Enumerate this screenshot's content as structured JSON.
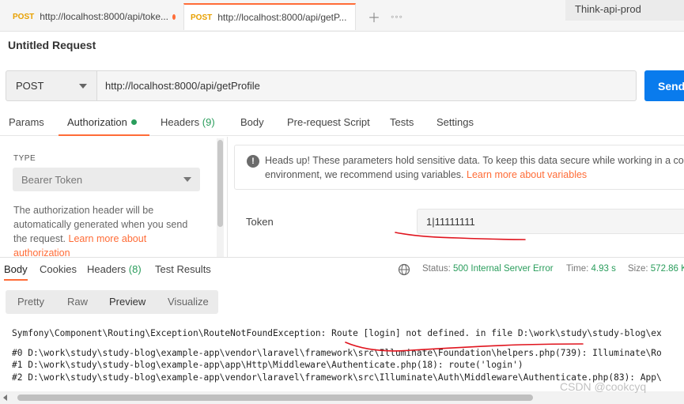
{
  "tabs": [
    {
      "method": "POST",
      "url": "http://localhost:8000/api/toke..."
    },
    {
      "method": "POST",
      "url": "http://localhost:8000/api/getP..."
    }
  ],
  "environment": "Think-api-prod",
  "request": {
    "title": "Untitled Request",
    "method": "POST",
    "url": "http://localhost:8000/api/getProfile",
    "send_label": "Send"
  },
  "request_tabs": {
    "params": "Params",
    "authorization": "Authorization",
    "headers": "Headers",
    "headers_count": "(9)",
    "body": "Body",
    "prerequest": "Pre-request Script",
    "tests": "Tests",
    "settings": "Settings"
  },
  "auth": {
    "type_label": "TYPE",
    "type_value": "Bearer Token",
    "description": "The authorization header will be automatically generated when you send the request.",
    "learn_more": "Learn more about authorization",
    "notice_text": "Heads up! These parameters hold sensitive data. To keep this data secure while working in a co environment, we recommend using variables.",
    "notice_link": "Learn more about variables",
    "token_label": "Token",
    "token_value": "1|11111111"
  },
  "response": {
    "tabs": {
      "body": "Body",
      "cookies": "Cookies",
      "headers": "Headers",
      "headers_count": "(8)",
      "test_results": "Test Results"
    },
    "status_label": "Status:",
    "status_value": "500 Internal Server Error",
    "time_label": "Time:",
    "time_value": "4.93 s",
    "size_label": "Size:",
    "size_value": "572.86 K",
    "formats": {
      "pretty": "Pretty",
      "raw": "Raw",
      "preview": "Preview",
      "visualize": "Visualize"
    },
    "lines": [
      "Symfony\\Component\\Routing\\Exception\\RouteNotFoundException: Route [login] not defined. in file D:\\work\\study\\study-blog\\ex",
      "#0 D:\\work\\study\\study-blog\\example-app\\vendor\\laravel\\framework\\src\\Illuminate\\Foundation\\helpers.php(739): Illuminate\\Ro",
      "#1 D:\\work\\study\\study-blog\\example-app\\app\\Http\\Middleware\\Authenticate.php(18): route('login')",
      "#2 D:\\work\\study\\study-blog\\example-app\\vendor\\laravel\\framework\\src\\Illuminate\\Auth\\Middleware\\Authenticate.php(83): App\\"
    ]
  },
  "watermark": "CSDN @cookcyq",
  "colors": {
    "accent": "#ff6c37",
    "send": "#097bed",
    "ok_green": "#2a9d5c",
    "annotation_red": "#e0141e"
  }
}
